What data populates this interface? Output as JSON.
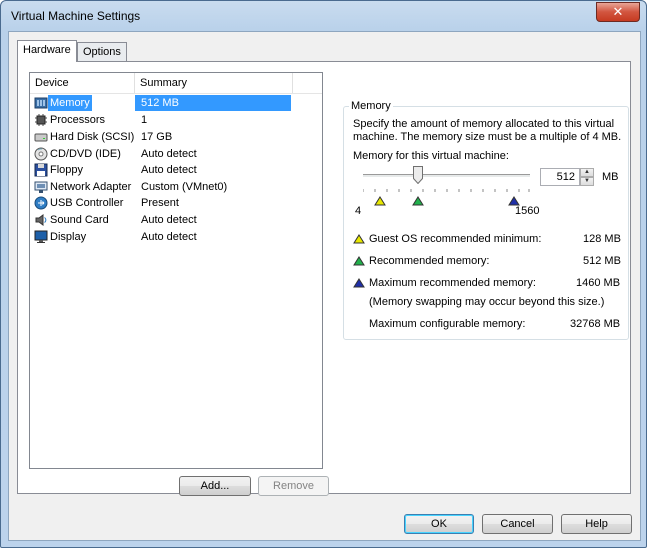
{
  "window": {
    "title": "Virtual Machine Settings"
  },
  "tabs": [
    {
      "label": "Hardware"
    },
    {
      "label": "Options"
    }
  ],
  "device_table": {
    "columns": [
      "Device",
      "Summary"
    ],
    "rows": [
      {
        "device": "Memory",
        "summary": "512 MB",
        "icon": "memory-icon",
        "selected": true
      },
      {
        "device": "Processors",
        "summary": "1",
        "icon": "processor-icon"
      },
      {
        "device": "Hard Disk (SCSI)",
        "summary": "17 GB",
        "icon": "hard-disk-icon"
      },
      {
        "device": "CD/DVD (IDE)",
        "summary": "Auto detect",
        "icon": "cd-dvd-icon"
      },
      {
        "device": "Floppy",
        "summary": "Auto detect",
        "icon": "floppy-icon"
      },
      {
        "device": "Network Adapter",
        "summary": "Custom (VMnet0)",
        "icon": "network-adapter-icon"
      },
      {
        "device": "USB Controller",
        "summary": "Present",
        "icon": "usb-icon"
      },
      {
        "device": "Sound Card",
        "summary": "Auto detect",
        "icon": "sound-card-icon"
      },
      {
        "device": "Display",
        "summary": "Auto detect",
        "icon": "display-icon"
      }
    ]
  },
  "list_buttons": {
    "add": "Add...",
    "remove": "Remove"
  },
  "memory_panel": {
    "group_title": "Memory",
    "description_line1": "Specify the amount of memory allocated to this virtual",
    "description_line2": "machine. The memory size must be a multiple of 4 MB.",
    "field_label": "Memory for this virtual machine:",
    "value": "512",
    "unit": "MB",
    "slider_min": "4",
    "slider_max": "1560",
    "slider_value": 512,
    "info": [
      {
        "label": "Guest OS recommended minimum:",
        "value": "128 MB",
        "color": "#e8e800"
      },
      {
        "label": "Recommended memory:",
        "value": "512 MB",
        "color": "#22b14c"
      },
      {
        "label": "Maximum recommended memory:",
        "value": "1460 MB",
        "color": "#1f2fa8"
      }
    ],
    "swap_note": "(Memory swapping may occur beyond this size.)",
    "max_configurable_label": "Maximum configurable memory:",
    "max_configurable_value": "32768 MB"
  },
  "dialog_buttons": {
    "ok": "OK",
    "cancel": "Cancel",
    "help": "Help"
  }
}
